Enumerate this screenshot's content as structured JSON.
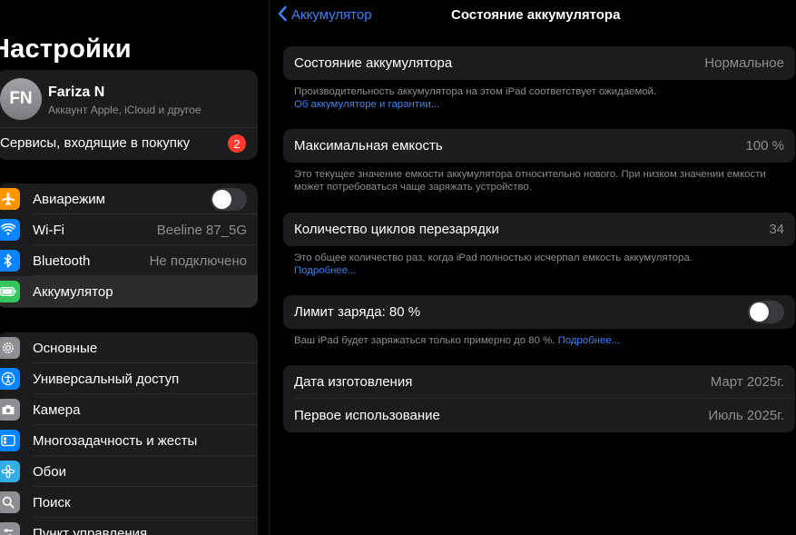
{
  "sidebar": {
    "title": "Настройки",
    "account": {
      "initials": "FN",
      "name": "Fariza N",
      "subtitle": "Аккаунт Apple, iCloud и другое",
      "services_label": "Сервисы, входящие в покупку",
      "badge": "2"
    },
    "connectivity": [
      {
        "label": "Авиарежим",
        "icon": "airplane-icon",
        "color": "#ff9500",
        "toggle": "off"
      },
      {
        "label": "Wi-Fi",
        "icon": "wifi-icon",
        "color": "#0a84ff",
        "value": "Beeline 87_5G"
      },
      {
        "label": "Bluetooth",
        "icon": "bluetooth-icon",
        "color": "#0a84ff",
        "value": "Не подключено"
      },
      {
        "label": "Аккумулятор",
        "icon": "battery-icon",
        "color": "#34c759",
        "selected": true
      }
    ],
    "general": [
      {
        "label": "Основные",
        "icon": "gear-icon",
        "color": "#8e8e93"
      },
      {
        "label": "Универсальный доступ",
        "icon": "accessibility-icon",
        "color": "#0a84ff"
      },
      {
        "label": "Камера",
        "icon": "camera-icon",
        "color": "#8e8e93"
      },
      {
        "label": "Многозадачность и жесты",
        "icon": "multitasking-icon",
        "color": "#0a84ff"
      },
      {
        "label": "Обои",
        "icon": "wallpaper-icon",
        "color": "#32ade6"
      },
      {
        "label": "Поиск",
        "icon": "search-icon",
        "color": "#8e8e93"
      },
      {
        "label": "Пункт управления",
        "icon": "control-center-icon",
        "color": "#8e8e93"
      }
    ]
  },
  "nav": {
    "back_label": "Аккумулятор",
    "title": "Состояние аккумулятора"
  },
  "detail": {
    "health": {
      "label": "Состояние аккумулятора",
      "value": "Нормальное",
      "footer": "Производительность аккумулятора на этом iPad соответствует ожидаемой.",
      "footer_link": "Об аккумуляторе и гарантии..."
    },
    "capacity": {
      "label": "Максимальная емкость",
      "value": "100 %",
      "footer": "Это текущее значение емкости аккумулятора относительно нового. При низком значении емкости может потребоваться чаще заряжать устройство."
    },
    "cycles": {
      "label": "Количество циклов перезарядки",
      "value": "34",
      "footer": "Это общее количество раз, когда iPad полностью исчерпал емкость аккумулятора.",
      "footer_link": "Подробнее..."
    },
    "limit": {
      "label": "Лимит заряда: 80 %",
      "toggle": "off",
      "footer": "Ваш iPad будет заряжаться только примерно до 80 %.",
      "footer_link": "Подробнее..."
    },
    "dates": {
      "manufacture_label": "Дата изготовления",
      "manufacture_value": "Март 2025г.",
      "first_use_label": "Первое использование",
      "first_use_value": "Июль 2025г."
    }
  },
  "colors": {
    "accent": "#3a82f7",
    "badge": "#ff3b30",
    "card": "#1c1c1e",
    "background": "#000000"
  }
}
